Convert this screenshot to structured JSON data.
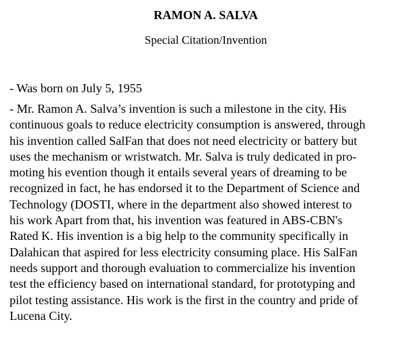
{
  "title": "RAMON A. SALVA",
  "subtitle": "Special Citation/Invention",
  "born": "- Was born on July 5, 1955",
  "description_lines": [
    "- Mr. Ramon A. Salva’s invention is such a milestone in the city. His",
    "continuous goals to reduce electricity consumption is answered, through",
    "his invention called SalFan that does not need electricity or battery but",
    "uses the mechanism or wristwatch. Mr. Salva is truly dedicated in pro-",
    "moting his evention though it entails several years of dreaming to be",
    "recognized in fact, he has endorsed it to the Department of Science and",
    "Technology (DOSTI, where in the department also showed interest to",
    "his work Apart from that, his invention was featured in ABS-CBN's",
    "Rated K. His invention is a big help to the community specifically in",
    "Dalahican that aspired for less electricity consuming place. His SalFan",
    "needs support and thorough evaluation to commercialize his invention",
    "test the efficiency based on international standard, for prototyping and",
    "pilot testing assistance. His work is the first in the country and pride of",
    "Lucena City."
  ]
}
